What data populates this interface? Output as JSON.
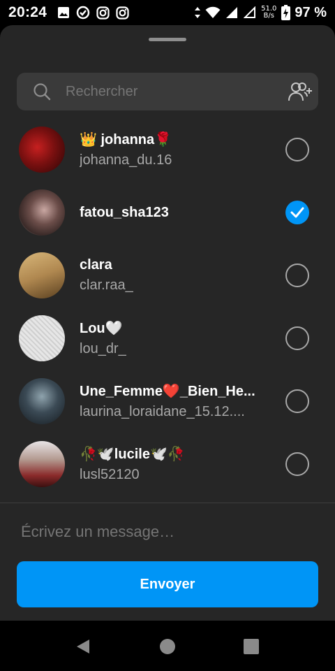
{
  "status_bar": {
    "time": "20:24",
    "net_speed_value": "51.0",
    "net_speed_unit": "B/s",
    "battery": "97 %",
    "left_icons": [
      "image-icon",
      "vpn-icon",
      "instagram-icon",
      "instagram-icon"
    ],
    "right_icons": [
      "data-arrows-icon",
      "wifi-icon",
      "signal-icon",
      "signal-empty-icon",
      "battery-charging-icon"
    ]
  },
  "search": {
    "placeholder": "Rechercher",
    "icon": "search-icon",
    "action_icon": "add-people-icon"
  },
  "contacts": [
    {
      "name": "👑 johanna🌹",
      "username": "johanna_du.16",
      "selected": false,
      "avatar_color": "#7a1414"
    },
    {
      "name": "fatou_sha123",
      "username": "",
      "selected": true,
      "avatar_color": "#5a4a48"
    },
    {
      "name": "clara",
      "username": "clar.raa_",
      "selected": false,
      "avatar_color": "#b8925a"
    },
    {
      "name": "Lou🤍",
      "username": "lou_dr_",
      "selected": false,
      "avatar_color": "#d9d9d9"
    },
    {
      "name": "Une_Femme❤️_Bien_He...",
      "username": "laurina_loraidane_15.12....",
      "selected": false,
      "avatar_color": "#3a4550"
    },
    {
      "name": "🥀🕊️lucile🕊️🥀",
      "username": "lusl52120",
      "selected": false,
      "avatar_color": "#8a6f68"
    }
  ],
  "composer": {
    "placeholder": "Écrivez un message…",
    "send_label": "Envoyer"
  },
  "colors": {
    "sheet_bg": "#262626",
    "accent": "#0095f6",
    "secondary_text": "#a8a8a8"
  },
  "nav": [
    "back-icon",
    "home-icon",
    "recents-icon"
  ]
}
